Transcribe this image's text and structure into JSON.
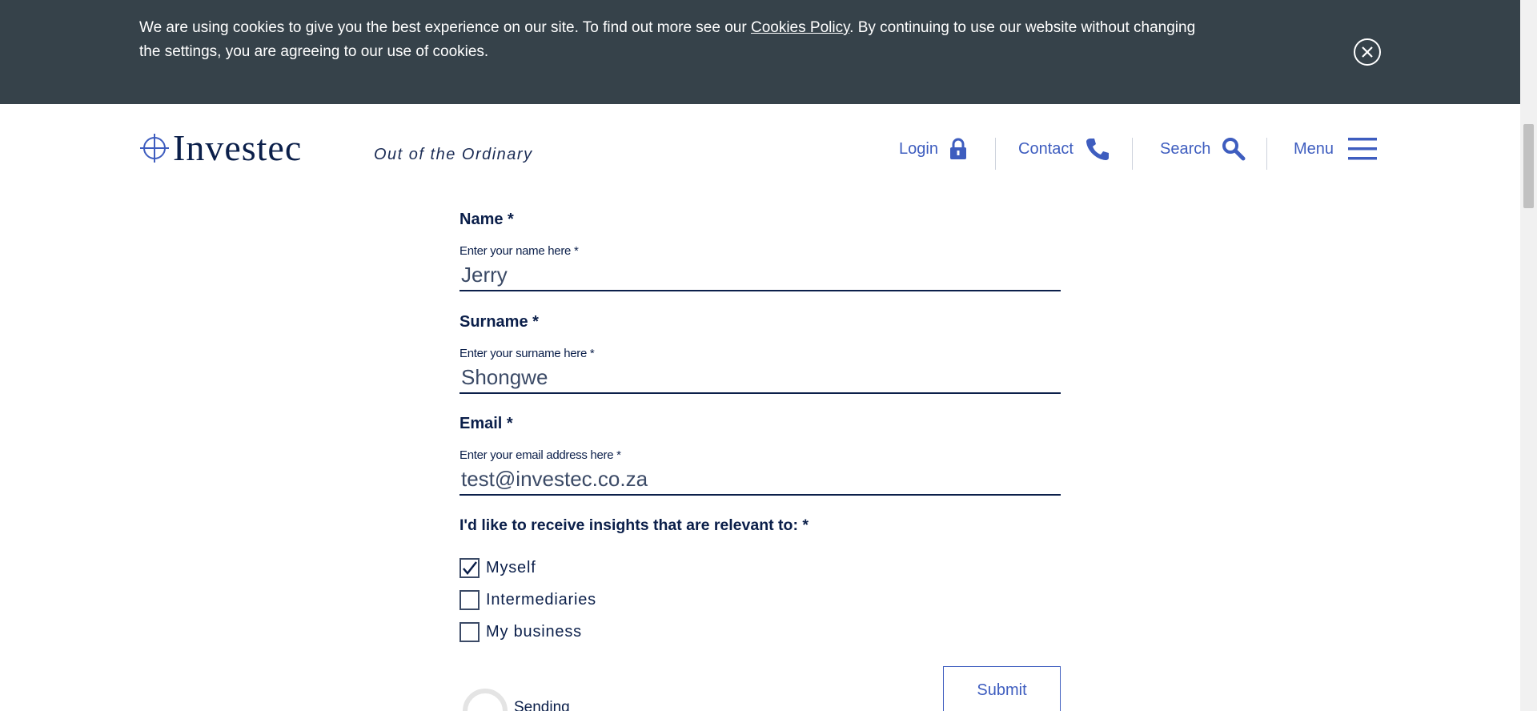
{
  "cookie_banner": {
    "text_before": "We are using cookies to give you the best experience on our site. To find out more see our ",
    "link": "Cookies Policy",
    "text_after": ". By continuing to use our website without changing the settings, you are agreeing to our use of cookies.",
    "close_icon": "close-circle-icon"
  },
  "header": {
    "logo": "Investec",
    "tagline": "Out of the Ordinary",
    "nav": {
      "login": "Login",
      "contact": "Contact",
      "search": "Search",
      "menu": "Menu"
    },
    "accent_color": "#3e5dbf",
    "brand_color": "#0b1f4a"
  },
  "form": {
    "name": {
      "title": "Name *",
      "label": "Enter your name here *",
      "value": "Jerry"
    },
    "surname": {
      "title": "Surname *",
      "label": "Enter your surname here *",
      "value": "Shongwe"
    },
    "email": {
      "title": "Email *",
      "label": "Enter your email address here *",
      "value": "test@investec.co.za"
    },
    "insights": {
      "title": "I'd like to receive insights that are relevant to: *",
      "options": [
        {
          "label": "Myself",
          "checked": true
        },
        {
          "label": "Intermediaries",
          "checked": false
        },
        {
          "label": "My business",
          "checked": false
        }
      ]
    },
    "submit_label": "Submit",
    "sending_label": "Sending"
  }
}
